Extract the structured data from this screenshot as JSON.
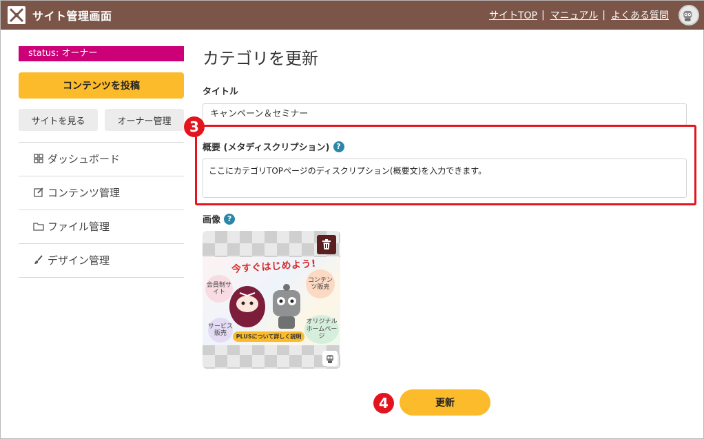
{
  "header": {
    "title": "サイト管理画面",
    "nav": [
      {
        "label": "サイトTOP"
      },
      {
        "label": "マニュアル"
      },
      {
        "label": "よくある質問"
      }
    ],
    "separator": "|"
  },
  "sidebar": {
    "status": "status: オーナー",
    "post_button": "コンテンツを投稿",
    "view_site_button": "サイトを見る",
    "owner_manage_button": "オーナー管理",
    "menu": [
      {
        "label": "ダッシュボード",
        "icon": "dashboard-icon"
      },
      {
        "label": "コンテンツ管理",
        "icon": "edit-icon"
      },
      {
        "label": "ファイル管理",
        "icon": "folder-icon"
      },
      {
        "label": "デザイン管理",
        "icon": "brush-icon"
      }
    ]
  },
  "main": {
    "page_title": "カテゴリを更新",
    "title_label": "タイトル",
    "title_value": "キャンペーン＆セミナー",
    "description_label": "概要 (メタディスクリプション)",
    "description_value": "ここにカテゴリTOPページのディスクリプション(概要文)を入力できます。",
    "image_label": "画像",
    "help_glyph": "?",
    "image_preview": {
      "banner": "今すぐはじめよう!",
      "bubbles": [
        "会員制サイト",
        "コンテンツ販売",
        "オリジナルホームページ",
        "サービス販売"
      ],
      "button": "PLUSについて詳しく説明"
    },
    "update_button": "更新"
  },
  "annotations": {
    "step3": "3",
    "step4": "4",
    "highlight_color": "#e3141e"
  },
  "colors": {
    "header_bg": "#7a5548",
    "status_bg": "#cc0077",
    "accent": "#fbbb2a",
    "help": "#2a87a8"
  }
}
